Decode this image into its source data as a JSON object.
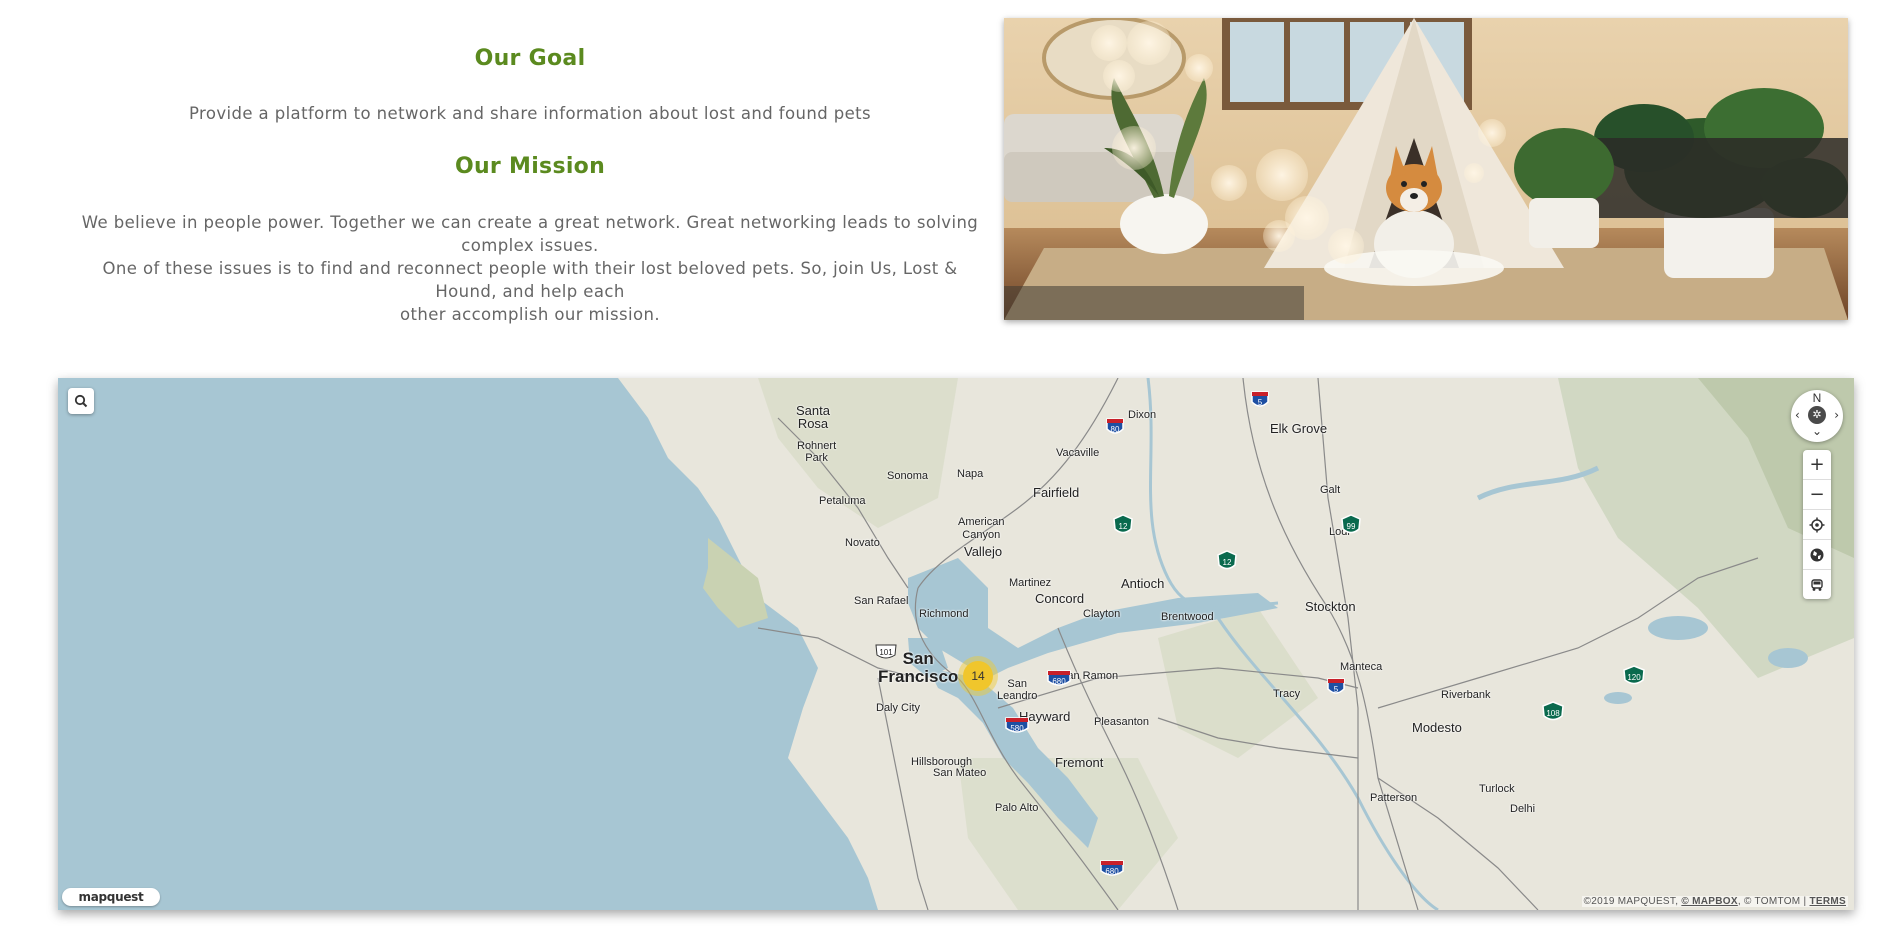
{
  "goal": {
    "title": "Our Goal",
    "text": "Provide a platform to network and share information about lost and found pets"
  },
  "mission": {
    "title": "Our Mission",
    "lines": [
      "We believe in people power. Together we can create a great network. Great networking leads to solving complex issues.",
      "One of these issues is to find and reconnect people with their lost beloved pets. So, join Us, Lost & Hound, and help each",
      "other accomplish our mission."
    ]
  },
  "hero_image": {
    "subject": "corgi-in-teepee-photo"
  },
  "map": {
    "cluster_count": "14",
    "controls": {
      "compass_north": "N",
      "zoom_in": "+",
      "zoom_out": "−"
    },
    "logo_text": "mapquest",
    "attribution": {
      "prefix": "©2019 MAPQUEST,",
      "mapbox": "© MAPBOX",
      "tomtom": ", © TOMTOM |",
      "terms": "TERMS"
    },
    "places": [
      {
        "id": "santa-rosa",
        "text": "Santa\nRosa"
      },
      {
        "id": "dixon",
        "text": "Dixon"
      },
      {
        "id": "elk-grove",
        "text": "Elk Grove"
      },
      {
        "id": "rohnert-park",
        "text": "Rohnert\nPark"
      },
      {
        "id": "vacaville",
        "text": "Vacaville"
      },
      {
        "id": "sonoma",
        "text": "Sonoma"
      },
      {
        "id": "napa",
        "text": "Napa"
      },
      {
        "id": "fairfield",
        "text": "Fairfield"
      },
      {
        "id": "galt",
        "text": "Galt"
      },
      {
        "id": "petaluma",
        "text": "Petaluma"
      },
      {
        "id": "lodi",
        "text": "Lodi"
      },
      {
        "id": "american-canyon",
        "text": "American\nCanyon"
      },
      {
        "id": "novato",
        "text": "Novato"
      },
      {
        "id": "vallejo",
        "text": "Vallejo"
      },
      {
        "id": "martinez",
        "text": "Martinez"
      },
      {
        "id": "antioch",
        "text": "Antioch"
      },
      {
        "id": "concord",
        "text": "Concord"
      },
      {
        "id": "san-rafael",
        "text": "San Rafael"
      },
      {
        "id": "clayton",
        "text": "Clayton"
      },
      {
        "id": "stockton",
        "text": "Stockton"
      },
      {
        "id": "richmond",
        "text": "Richmond"
      },
      {
        "id": "brentwood",
        "text": "Brentwood"
      },
      {
        "id": "san-francisco",
        "text": "San\nFrancisco"
      },
      {
        "id": "manteca",
        "text": "Manteca"
      },
      {
        "id": "san-ramon",
        "text": "San Ramon"
      },
      {
        "id": "san-leandro",
        "text": "San\nLeandro"
      },
      {
        "id": "daly-city",
        "text": "Daly City"
      },
      {
        "id": "tracy",
        "text": "Tracy"
      },
      {
        "id": "riverbank",
        "text": "Riverbank"
      },
      {
        "id": "hayward",
        "text": "Hayward"
      },
      {
        "id": "pleasanton",
        "text": "Pleasanton"
      },
      {
        "id": "modesto",
        "text": "Modesto"
      },
      {
        "id": "hillsborough",
        "text": "Hillsborough"
      },
      {
        "id": "san-mateo",
        "text": "San Mateo"
      },
      {
        "id": "fremont",
        "text": "Fremont"
      },
      {
        "id": "turlock",
        "text": "Turlock"
      },
      {
        "id": "patterson",
        "text": "Patterson"
      },
      {
        "id": "palo-alto",
        "text": "Palo Alto"
      },
      {
        "id": "delhi",
        "text": "Delhi"
      }
    ],
    "route_shields": [
      {
        "id": "i5-north",
        "kind": "interstate",
        "num": "5"
      },
      {
        "id": "i80",
        "kind": "interstate",
        "num": "80"
      },
      {
        "id": "sr12-west",
        "kind": "state",
        "num": "12"
      },
      {
        "id": "sr99",
        "kind": "state",
        "num": "99"
      },
      {
        "id": "sr12-east",
        "kind": "state",
        "num": "12"
      },
      {
        "id": "us101",
        "kind": "us",
        "num": "101"
      },
      {
        "id": "i680-north",
        "kind": "interstate",
        "num": "680"
      },
      {
        "id": "i5-south",
        "kind": "interstate",
        "num": "5"
      },
      {
        "id": "sr120",
        "kind": "state",
        "num": "120"
      },
      {
        "id": "sr108",
        "kind": "state",
        "num": "108"
      },
      {
        "id": "i580",
        "kind": "interstate",
        "num": "580"
      },
      {
        "id": "i680-south",
        "kind": "interstate",
        "num": "680"
      }
    ]
  }
}
